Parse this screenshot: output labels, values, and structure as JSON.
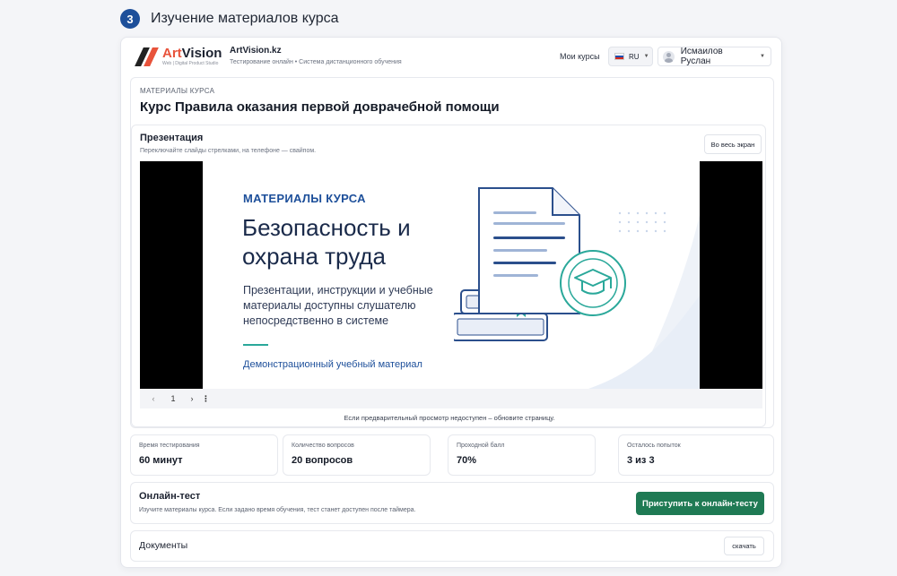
{
  "step": {
    "number": "3",
    "title": "Изучение материалов курса"
  },
  "header": {
    "logo": {
      "art": "Art",
      "vision": "Vision",
      "subtitle": "Web | Digital Product Studio"
    },
    "site_name": "ArtVision.kz",
    "site_desc": "Тестирование онлайн • Система дистанционного обучения",
    "my_courses": "Мои курсы",
    "language": "RU",
    "user_name": "Исмаилов Руслан"
  },
  "course": {
    "breadcrumb": "МАТЕРИАЛЫ КУРСА",
    "title": "Курс Правила оказания первой доврачебной помощи"
  },
  "presentation": {
    "title": "Презентация",
    "hint": "Переключайте слайды стрелками, на телефоне — свайпом.",
    "fullscreen_label": "Во весь экран",
    "slide": {
      "kicker": "МАТЕРИАЛЫ КУРСА",
      "title": "Безопасность и охрана труда",
      "description": "Презентации, инструкции и учебные материалы доступны слушателю непосредственно в системе",
      "footer": "Демонстрационный учебный материал"
    },
    "nav": {
      "prev": "‹",
      "page": "1",
      "next": "›",
      "more": "⋮"
    },
    "preview_note": "Если предварительный просмотр недоступен – обновите страницу."
  },
  "stats": [
    {
      "label": "Время тестирования",
      "value": "60 минут"
    },
    {
      "label": "Количество вопросов",
      "value": "20 вопросов"
    },
    {
      "label": "Проходной балл",
      "value": "70%"
    },
    {
      "label": "Осталось попыток",
      "value": "3 из 3"
    }
  ],
  "online_test": {
    "title": "Онлайн-тест",
    "description": "Изучите материалы курса. Если задано время обучения, тест станет доступен после таймера.",
    "start_label": "Приступить к онлайн-тесту"
  },
  "documents": {
    "title": "Документы",
    "download_label": "скачать"
  },
  "colors": {
    "primary": "#1d4f9a",
    "accent": "#2aa89a",
    "brand_red": "#e8533b",
    "action_green": "#1f7a54"
  },
  "icons": [
    "avatar-icon",
    "flag-ru-icon",
    "chevron-down-icon",
    "document-icon",
    "book-icon",
    "graduation-cap-icon"
  ]
}
